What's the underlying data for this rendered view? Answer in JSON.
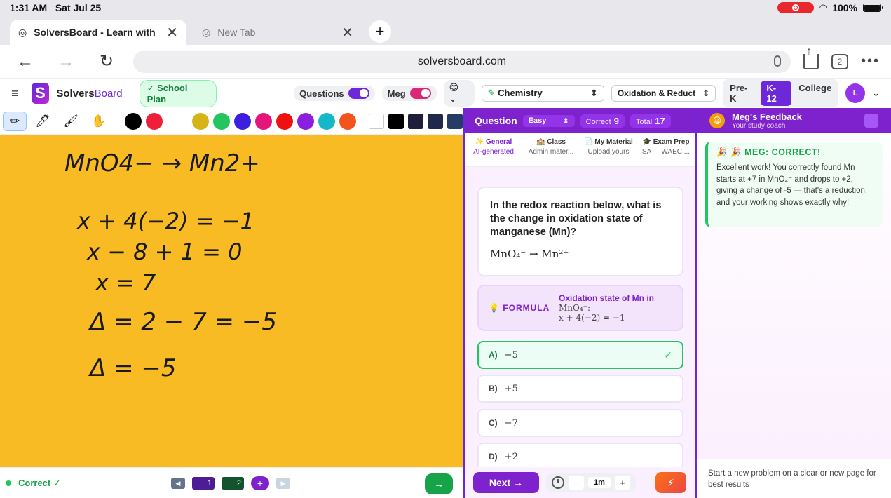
{
  "status_bar": {
    "time": "1:31 AM",
    "date": "Sat Jul 25",
    "battery": "100%"
  },
  "browser": {
    "tabs": [
      {
        "title": "SolversBoard - Learn with",
        "active": true
      },
      {
        "title": "New Tab",
        "active": false
      }
    ],
    "url": "solversboard.com",
    "tab_count": "2"
  },
  "app": {
    "brand_first": "Solvers",
    "brand_second": "Board",
    "logo_letter": "S",
    "plan_badge": "✓ School Plan",
    "questions_toggle": "Questions",
    "meg_toggle": "Meg",
    "emoji": "😊",
    "subject": "Chemistry",
    "topic": "Oxidation & Reduct",
    "levels": [
      "Pre-K",
      "K-12",
      "College"
    ],
    "active_level": "K-12",
    "avatar_initial": "L"
  },
  "canvas": {
    "status": "Correct ✓",
    "pages": [
      "1",
      "2"
    ],
    "handwriting": [
      "MnO4− → Mn2+",
      "x + 4(−2) = −1",
      "x − 8 + 1 = 0",
      "x = 7",
      "Δ = 2 − 7 = −5",
      "Δ = −5"
    ],
    "colors": {
      "canvas_bg": "#f9bb24",
      "palette": [
        "#000000",
        "#ef1f3a",
        "#d4b417",
        "#22c55e",
        "#3b1ee0",
        "#e5157a",
        "#ef1010",
        "#8b1fe0",
        "#14b8c8",
        "#f2541b"
      ],
      "squares": [
        "#ffffff",
        "#000000",
        "#1e1e3a",
        "#1f2a4a",
        "#263b66"
      ]
    }
  },
  "question": {
    "header": "Question",
    "difficulty": "Easy",
    "correct_label": "Correct",
    "correct_count": "9",
    "total_label": "Total",
    "total_count": "17",
    "source_tabs": [
      {
        "title": "✨ General",
        "sub": "AI-generated"
      },
      {
        "title": "🏫 Class",
        "sub": "Admin mater..."
      },
      {
        "title": "📄 My Material",
        "sub": "Upload yours"
      },
      {
        "title": "🎓 Exam Prep",
        "sub": "SAT · WAEC ..."
      }
    ],
    "text": "In the redox reaction below, what is the change in oxidation state of manganese (Mn)?",
    "expression": "MnO₄⁻ → Mn²⁺",
    "formula_label": "💡 FORMULA",
    "formula_title": "Oxidation state of Mn in",
    "formula_species": "MnO₄⁻:",
    "formula_math": "x + 4(−2) = −1",
    "choices": [
      {
        "letter": "A)",
        "value": "−5",
        "correct": true
      },
      {
        "letter": "B)",
        "value": "+5"
      },
      {
        "letter": "C)",
        "value": "−7"
      },
      {
        "letter": "D)",
        "value": "+2"
      }
    ],
    "next_label": "Next →",
    "timer_value": "1m"
  },
  "feedback": {
    "title": "Meg's Feedback",
    "subtitle": "Your study coach",
    "card_head": "🎉 🎉 MEG: CORRECT!",
    "card_text": "Excellent work! You correctly found Mn starts at +7 in MnO₄⁻ and drops to +2, giving a change of -5 — that's a reduction, and your working shows exactly why!",
    "footer": "Start a new problem on a clear or new page for best results"
  }
}
